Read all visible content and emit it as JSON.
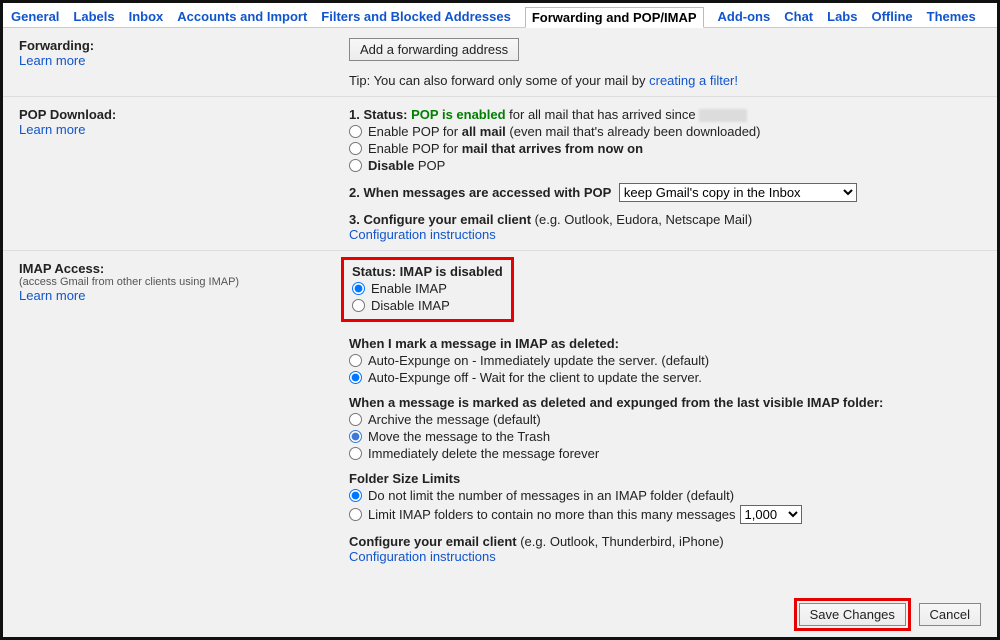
{
  "tabs": {
    "general": "General",
    "labels": "Labels",
    "inbox": "Inbox",
    "accounts": "Accounts and Import",
    "filters": "Filters and Blocked Addresses",
    "forwarding": "Forwarding and POP/IMAP",
    "addons": "Add-ons",
    "chat": "Chat",
    "labs": "Labs",
    "offline": "Offline",
    "themes": "Themes"
  },
  "forwarding": {
    "title": "Forwarding:",
    "learn_more": "Learn more",
    "add_button": "Add a forwarding address",
    "tip_prefix": "Tip: You can also forward only some of your mail by ",
    "tip_link": "creating a filter!"
  },
  "pop": {
    "title": "POP Download:",
    "learn_more": "Learn more",
    "status_prefix": "1. Status: ",
    "status_green": "POP is enabled",
    "status_suffix": " for all mail that has arrived since ",
    "opt_all_prefix": "Enable POP for ",
    "opt_all_bold": "all mail",
    "opt_all_suffix": " (even mail that's already been downloaded)",
    "opt_now_prefix": "Enable POP for ",
    "opt_now_bold": "mail that arrives from now on",
    "opt_disable_bold": "Disable",
    "opt_disable_suffix": " POP",
    "access_label": "2. When messages are accessed with POP",
    "access_selected": "keep Gmail's copy in the Inbox",
    "configure_bold": "3. Configure your email client",
    "configure_suffix": " (e.g. Outlook, Eudora, Netscape Mail)",
    "config_link": "Configuration instructions"
  },
  "imap": {
    "title": "IMAP Access:",
    "subtitle": "(access Gmail from other clients using IMAP)",
    "learn_more": "Learn more",
    "status_label": "Status: IMAP is disabled",
    "enable": "Enable IMAP",
    "disable": "Disable IMAP",
    "deleted_header": "When I mark a message in IMAP as deleted:",
    "expunge_on": "Auto-Expunge on - Immediately update the server. (default)",
    "expunge_off": "Auto-Expunge off - Wait for the client to update the server.",
    "expunged_header": "When a message is marked as deleted and expunged from the last visible IMAP folder:",
    "archive": "Archive the message (default)",
    "trash": "Move the message to the Trash",
    "delete_forever": "Immediately delete the message forever",
    "folder_limits": "Folder Size Limits",
    "no_limit": "Do not limit the number of messages in an IMAP folder (default)",
    "limit_prefix": "Limit IMAP folders to contain no more than this many messages",
    "limit_value": "1,000",
    "configure_bold": "Configure your email client",
    "configure_suffix": " (e.g. Outlook, Thunderbird, iPhone)",
    "config_link": "Configuration instructions"
  },
  "buttons": {
    "save": "Save Changes",
    "cancel": "Cancel"
  }
}
